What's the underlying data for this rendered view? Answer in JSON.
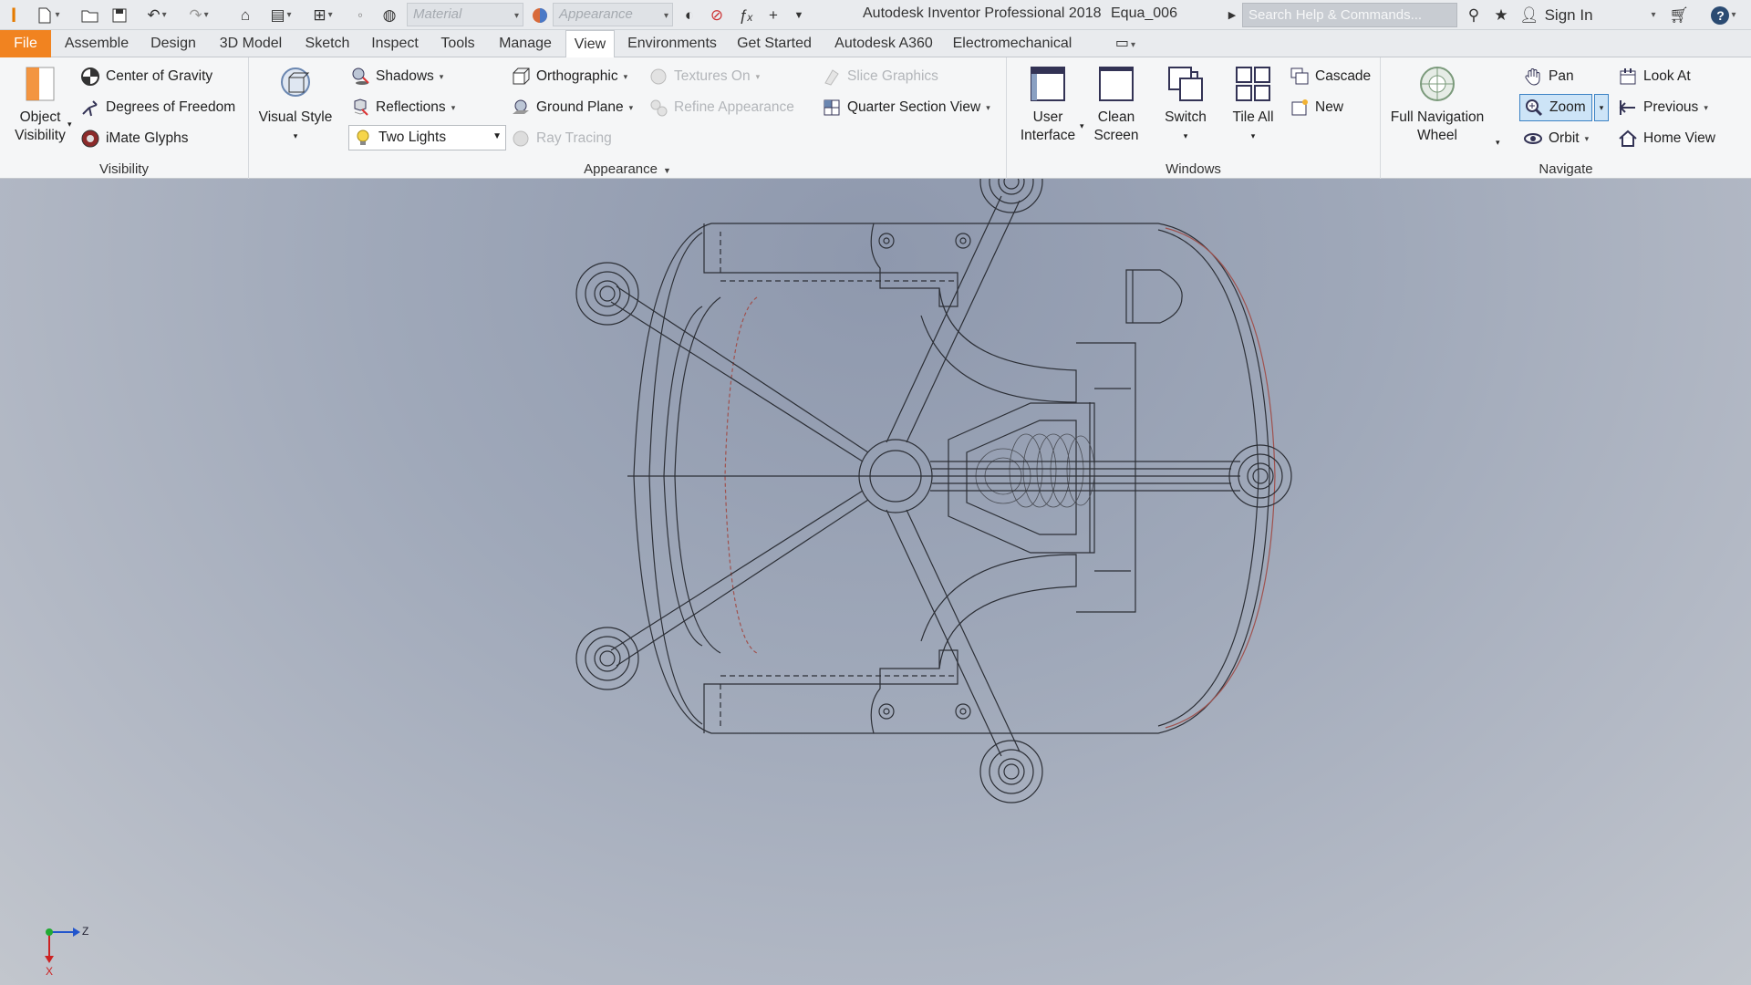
{
  "app": {
    "title": "Autodesk Inventor Professional 2018",
    "document": "Equa_006",
    "search_placeholder": "Search Help & Commands...",
    "sign_in": "Sign In",
    "material_placeholder": "Material",
    "appearance_placeholder": "Appearance"
  },
  "tabs": [
    "File",
    "Assemble",
    "Design",
    "3D Model",
    "Sketch",
    "Inspect",
    "Tools",
    "Manage",
    "View",
    "Environments",
    "Get Started",
    "Autodesk A360",
    "Electromechanical"
  ],
  "active_tab": "View",
  "ribbon": {
    "visibility": {
      "title": "Visibility",
      "object_visibility": "Object Visibility",
      "center_of_gravity": "Center of Gravity",
      "degrees_of_freedom": "Degrees of Freedom",
      "imate_glyphs": "iMate Glyphs"
    },
    "appearance": {
      "title": "Appearance",
      "visual_style": "Visual Style",
      "shadows": "Shadows",
      "reflections": "Reflections",
      "lighting_value": "Two Lights",
      "orthographic": "Orthographic",
      "ground_plane": "Ground Plane",
      "ray_tracing": "Ray Tracing",
      "textures_on": "Textures On",
      "refine_appearance": "Refine Appearance",
      "slice_graphics": "Slice Graphics",
      "quarter_section_view": "Quarter Section View"
    },
    "windows": {
      "title": "Windows",
      "user_interface": "User Interface",
      "clean_screen": "Clean Screen",
      "switch": "Switch",
      "tile_all": "Tile All",
      "cascade": "Cascade",
      "new": "New"
    },
    "navigate": {
      "title": "Navigate",
      "full_navigation_wheel": "Full Navigation Wheel",
      "pan": "Pan",
      "zoom": "Zoom",
      "orbit": "Orbit",
      "look_at": "Look At",
      "previous": "Previous",
      "home_view": "Home View"
    }
  },
  "triad": {
    "z": "Z",
    "x": "X"
  },
  "colors": {
    "file_tab": "#f18320",
    "zoom_highlight": "#cde4f7",
    "wireframe": "#2c2f36",
    "hidden_line": "#a0524e"
  }
}
